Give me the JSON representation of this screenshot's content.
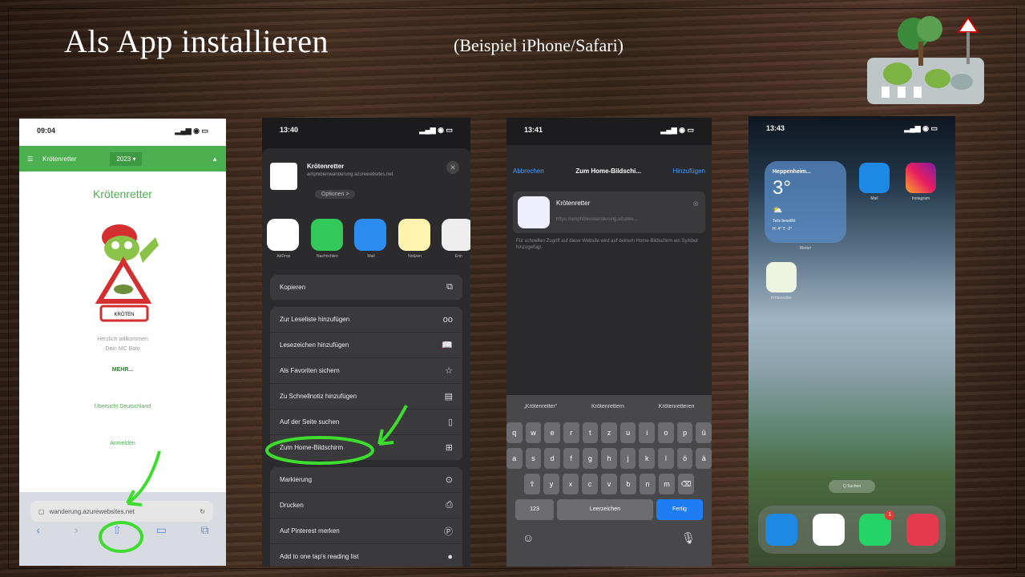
{
  "slide": {
    "title": "Als App installieren",
    "subtitle": "(Beispiel iPhone/Safari)"
  },
  "phone1": {
    "time": "09:04",
    "nav_brand": "Krötenretter",
    "nav_year": "2023 ▾",
    "heading": "Krötenretter",
    "welcome": "Herzlich willkommen",
    "user": "Dein MC Bolo",
    "more": "MEHR...",
    "overview": "Übersicht Deutschland",
    "login": "Anmelden",
    "url": "wanderung.azurewebsites.net"
  },
  "phone2": {
    "time": "13:40",
    "site_title": "Krötenretter",
    "site_sub": "amphibienwanderung.azurewebsites.net",
    "options": "Optionen >",
    "apps": [
      "AirDrop",
      "Nachrichten",
      "Mail",
      "Notizen",
      "Erin"
    ],
    "copy": "Kopieren",
    "rows": [
      {
        "label": "Zur Leseliste hinzufügen",
        "icon": "oo"
      },
      {
        "label": "Lesezeichen hinzufügen",
        "icon": "📖"
      },
      {
        "label": "Als Favoriten sichern",
        "icon": "☆"
      },
      {
        "label": "Zu Schnellnotiz hinzufügen",
        "icon": "▤"
      },
      {
        "label": "Auf der Seite suchen",
        "icon": "▯"
      },
      {
        "label": "Zum Home-Bildschirm",
        "icon": "⊞"
      }
    ],
    "rows2": [
      {
        "label": "Markierung",
        "icon": "⊙"
      },
      {
        "label": "Drucken",
        "icon": "⎙"
      },
      {
        "label": "Auf Pinterest merken",
        "icon": "Ⓟ"
      },
      {
        "label": "Add to one tap's reading list",
        "icon": "●"
      }
    ]
  },
  "phone3": {
    "time": "13:41",
    "cancel": "Abbrechen",
    "center": "Zum Home-Bildschi...",
    "add": "Hinzufügen",
    "app_name": "Krötenretter",
    "app_url": "https://amphibienwanderung.azurew...",
    "hint": "Für schnellen Zugriff auf diese Website wird auf deinem Home-Bildschirm ein Symbol hinzugefügt.",
    "suggestions": [
      "„Krötenretter“",
      "Krötenrettern",
      "Krötenretteren"
    ],
    "row1": [
      "q",
      "w",
      "e",
      "r",
      "t",
      "z",
      "u",
      "i",
      "o",
      "p",
      "ü"
    ],
    "row2": [
      "a",
      "s",
      "d",
      "f",
      "g",
      "h",
      "j",
      "k",
      "l",
      "ö",
      "ä"
    ],
    "row3": [
      "⇧",
      "y",
      "x",
      "c",
      "v",
      "b",
      "n",
      "m",
      "⌫"
    ],
    "num_key": "123",
    "space": "Leerzeichen",
    "done": "Fertig"
  },
  "phone4": {
    "time": "13:43",
    "city": "Heppenheim...",
    "temp": "3°",
    "cond": "Teils bewölkt",
    "range": "H: 4° T: -2°",
    "weather_label": "Wetter",
    "mail": "Mail",
    "instagram": "Instagram",
    "app_label": "Krötenretter",
    "search": "Q Suchen",
    "badge": "1"
  },
  "colors": {
    "green": "#4caf50",
    "ios_blue": "#4a9eff"
  }
}
